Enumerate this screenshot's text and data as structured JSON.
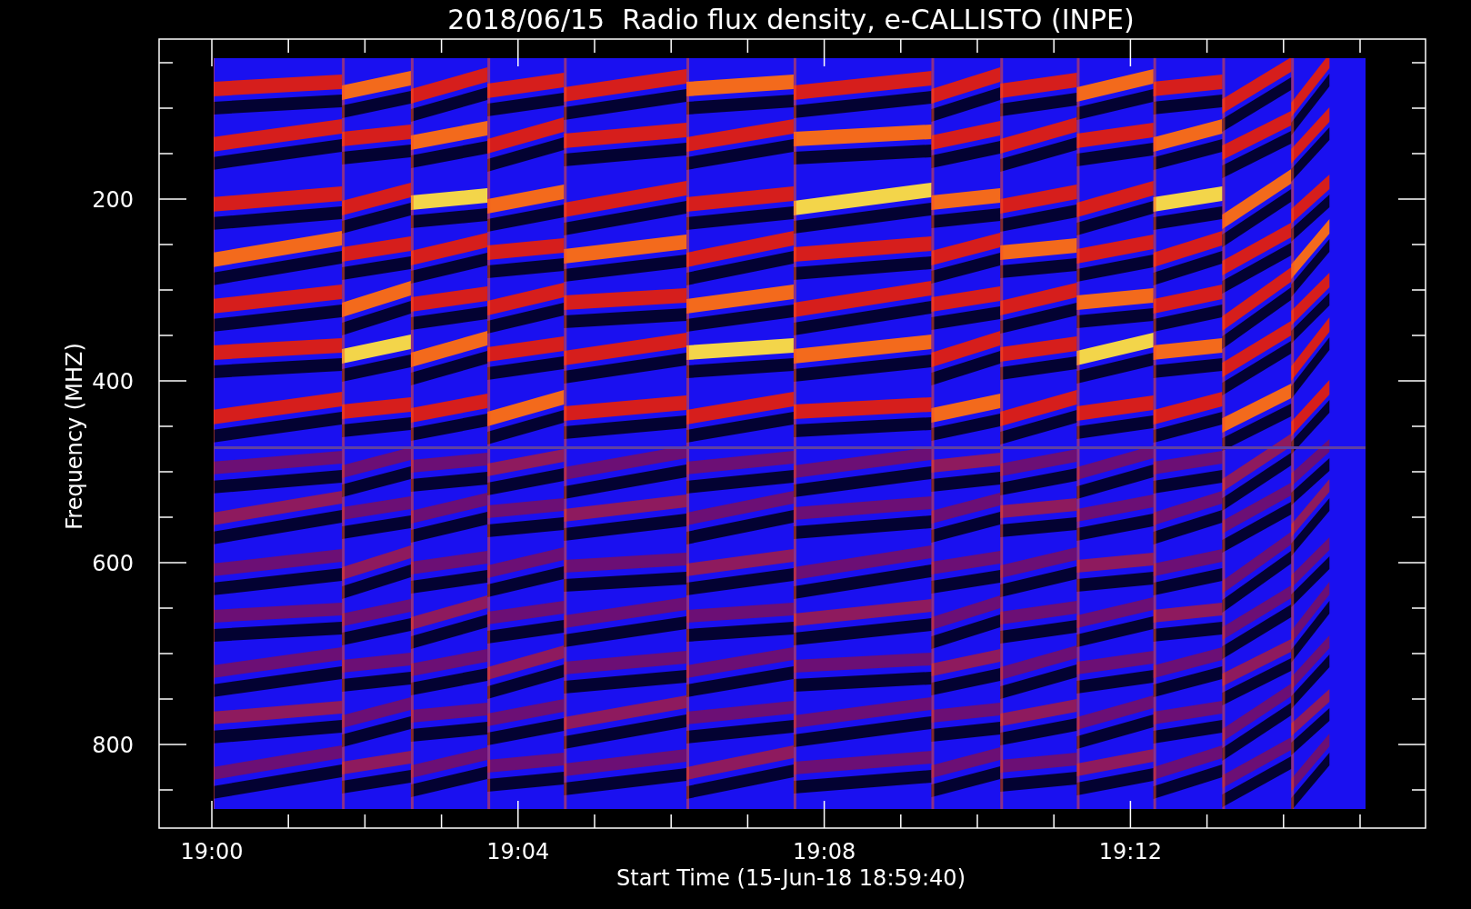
{
  "title": "2018/06/15  Radio flux density, e-CALLISTO (INPE)",
  "y_axis": {
    "label": "Frequency (MHZ)",
    "tick_labels": [
      "200",
      "400",
      "600",
      "800"
    ]
  },
  "x_axis": {
    "label": "Start Time (15-Jun-18 18:59:40)",
    "tick_labels": [
      "19:00",
      "19:04",
      "19:08",
      "19:12"
    ]
  }
}
